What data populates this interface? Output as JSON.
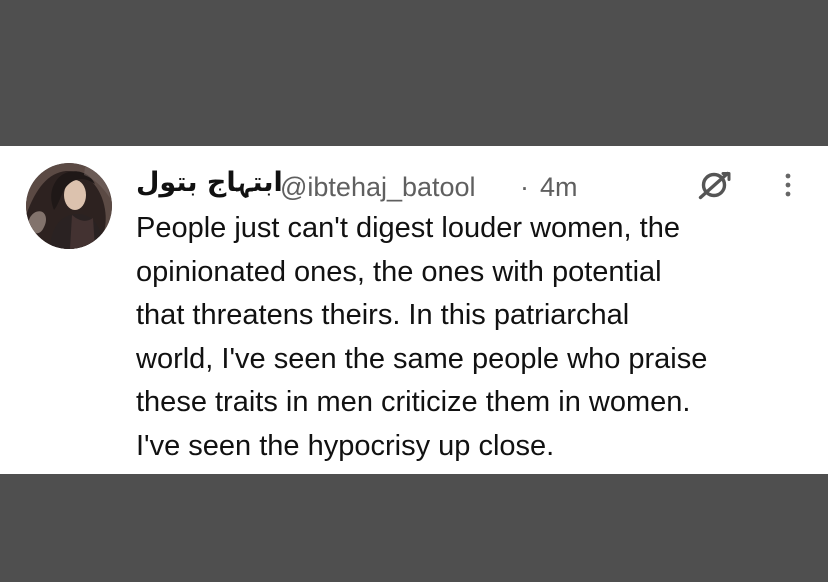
{
  "tweet": {
    "display_name": "ابتہاج بتول",
    "handle": "@ibtehaj_batool",
    "separator": "·",
    "timestamp": "4m",
    "text": "People just can't digest louder women, the\nopinionated ones, the ones with potential\nthat threatens theirs. In this patriarchal\nworld, I've seen the same people who praise\nthese traits in men criticize them in women.\nI've seen the hypocrisy up close."
  },
  "icons": {
    "avatar": "profile-photo",
    "grok": "grok-icon",
    "more": "more-icon"
  },
  "colors": {
    "background": "#4f4f4f",
    "card": "#ffffff",
    "text": "#111111",
    "secondary_text": "#5f5f5f"
  }
}
